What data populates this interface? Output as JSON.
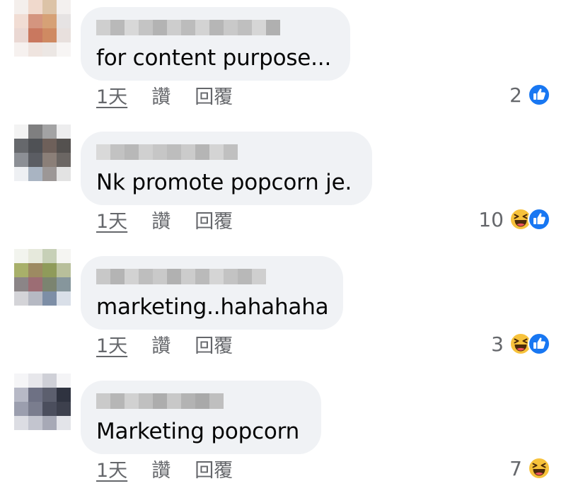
{
  "comments": [
    {
      "text": "for content purpose...",
      "time": "1天",
      "like": "讚",
      "reply": "回覆",
      "reaction_count": "2",
      "reactions": [
        "like-icon"
      ],
      "avatar_colors": [
        "#f4efec",
        "#f0d9cc",
        "#dcc3a7",
        "#f3f0ef",
        "#f1ddd4",
        "#d4957f",
        "#d6a176",
        "#e6e3e3",
        "#ead8d3",
        "#c9785f",
        "#cf8a62",
        "#e8e0dd",
        "#f6f1ef",
        "#efe4df",
        "#ece7e4",
        "#f7f5f4"
      ],
      "name_blur": [
        "#cfcfcf",
        "#b9b9b9",
        "#d8d8d8",
        "#c4c4c4",
        "#b3b3b3",
        "#cdcdcd",
        "#bcbcbc",
        "#d3d3d3",
        "#b6b6b6",
        "#c9c9c9",
        "#bfbfbf",
        "#d6d6d6",
        "#b0b0b0"
      ]
    },
    {
      "text": "Nk promote popcorn je.",
      "time": "1天",
      "like": "讚",
      "reply": "回覆",
      "reaction_count": "10",
      "reactions": [
        "haha-icon",
        "like-icon"
      ],
      "avatar_colors": [
        "#f3f3f3",
        "#7f7f80",
        "#a3a3a4",
        "#ededee",
        "#66686c",
        "#4f5155",
        "#6e605a",
        "#54514f",
        "#8c8f95",
        "#5b5d63",
        "#8b7f78",
        "#6b6663",
        "#eef0f3",
        "#a9b4c2",
        "#9c9796",
        "#e3e3e3"
      ],
      "name_blur": [
        "#d9d9d9",
        "#c2c2c2",
        "#b8b8b8",
        "#d0d0d0",
        "#c6c6c6",
        "#bdbdbd",
        "#cbcbcb",
        "#b5b5b5",
        "#d4d4d4",
        "#c0c0c0"
      ]
    },
    {
      "text": "marketing..hahahaha",
      "time": "1天",
      "like": "讚",
      "reply": "回覆",
      "reaction_count": "3",
      "reactions": [
        "haha-icon",
        "like-icon"
      ],
      "avatar_colors": [
        "#f2f4ee",
        "#e6e9dc",
        "#c7d0b7",
        "#f5f5f2",
        "#a8b06a",
        "#9d8a62",
        "#8f9b5a",
        "#b8bf9b",
        "#8b8587",
        "#9c6d74",
        "#7b8470",
        "#86969c",
        "#d4d4d8",
        "#b6b9c3",
        "#7d8ea6",
        "#d9dfe8"
      ],
      "name_blur": [
        "#c8c8c8",
        "#b4b4b4",
        "#d2d2d2",
        "#bebebe",
        "#c9c9c9",
        "#b1b1b1",
        "#cccccc",
        "#bababa",
        "#d5d5d5",
        "#c3c3c3",
        "#b8b8b8",
        "#cfcfcf"
      ]
    },
    {
      "text": "Marketing popcorn",
      "time": "1天",
      "like": "讚",
      "reply": "回覆",
      "reaction_count": "7",
      "reactions": [
        "haha-icon"
      ],
      "avatar_colors": [
        "#f5f5f7",
        "#e7e7eb",
        "#cfd0d7",
        "#f4f4f6",
        "#b7b9c6",
        "#6e7184",
        "#5c5f6e",
        "#2f3340",
        "#9b9eae",
        "#7a7d8e",
        "#4b4e5d",
        "#3d404d",
        "#dcdde3",
        "#c3c5cf",
        "#a7a9b6",
        "#e3e4e9"
      ],
      "name_blur": [
        "#cacaca",
        "#b6b6b6",
        "#d1d1d1",
        "#c0c0c0",
        "#adadad",
        "#c8c8c8",
        "#b3b3b3",
        "#a9a9a9",
        "#bfbfbf"
      ]
    }
  ]
}
